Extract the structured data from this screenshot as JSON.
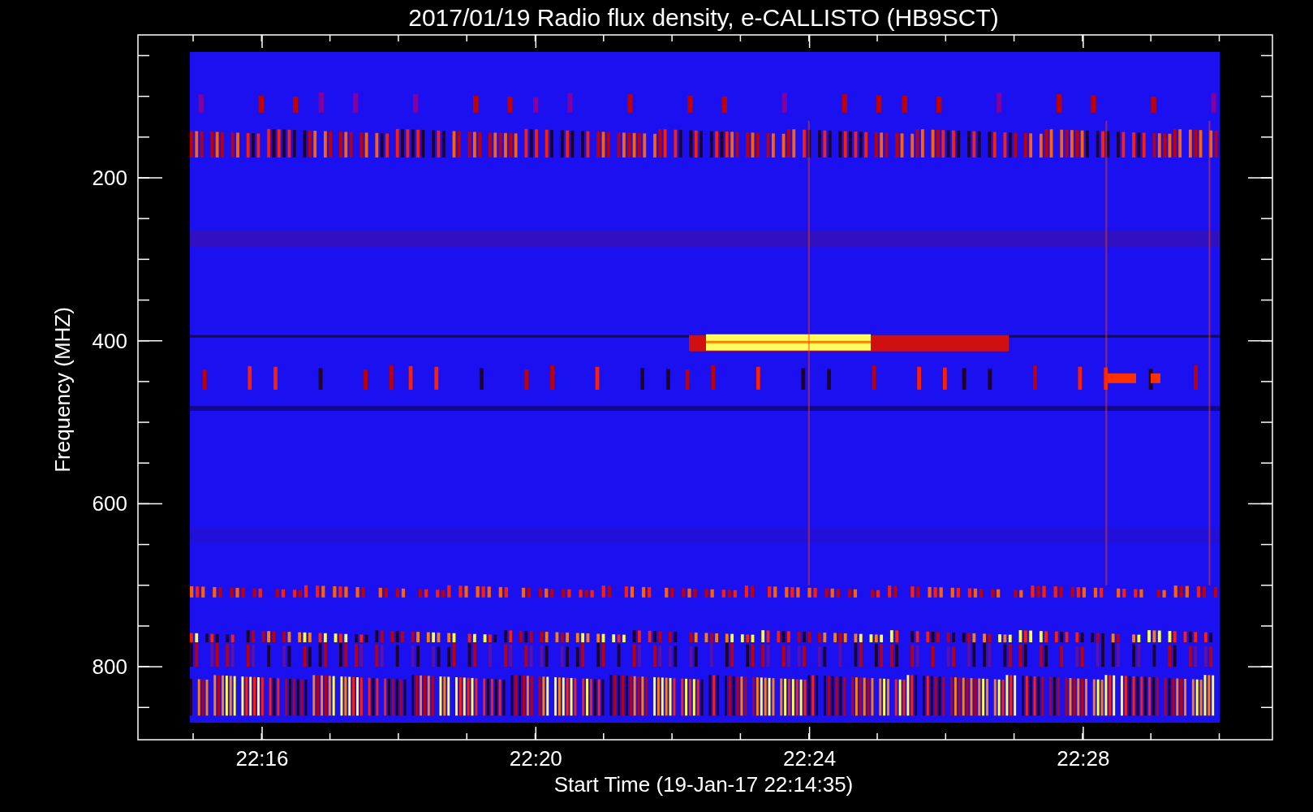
{
  "title": "2017/01/19  Radio flux density, e-CALLISTO (HB9SCT)",
  "xlabel": "Start Time (19-Jan-17 22:14:35)",
  "ylabel": "Frequency (MHZ)",
  "xticks": [
    "22:16",
    "22:20",
    "22:24",
    "22:28"
  ],
  "yticks": [
    "200",
    "400",
    "600",
    "800"
  ]
}
